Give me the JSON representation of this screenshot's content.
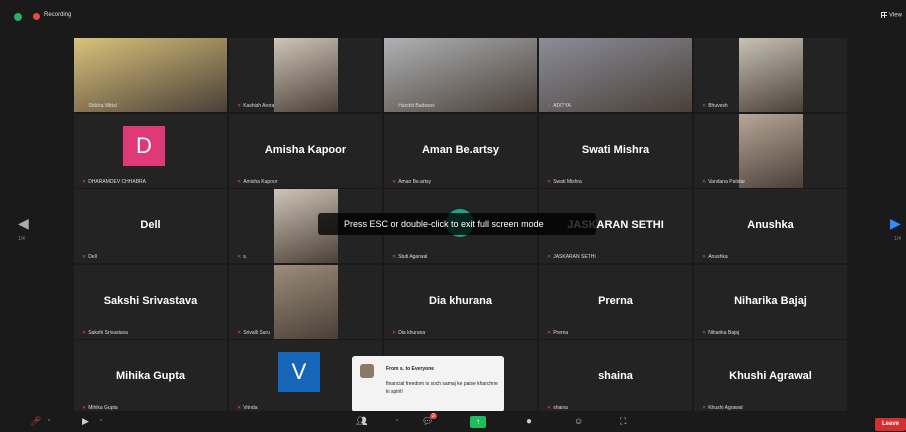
{
  "topbar": {
    "recording_label": "Recording",
    "view_label": "View"
  },
  "toast": "Press ESC or double-click to exit full screen mode",
  "pagination": {
    "left": "1/4",
    "right": "1/4"
  },
  "participants": [
    {
      "name": "Shikha Mittal",
      "display": "",
      "video": true
    },
    {
      "name": "Kashish Arora",
      "display": "",
      "video": true
    },
    {
      "name": "Harshit Badwani",
      "display": "",
      "video": true
    },
    {
      "name": "ADITYA",
      "display": "",
      "video": true
    },
    {
      "name": "Bhuvesh",
      "display": "",
      "video": true
    },
    {
      "name": "DHARAMDEV CHHABRA",
      "display": "",
      "avatar_letter": "D",
      "avatar_color": "#e0397a"
    },
    {
      "name": "Amisha Kapoor",
      "display": "Amisha Kapoor"
    },
    {
      "name": "Aman Be.artsy",
      "display": "Aman Be.artsy"
    },
    {
      "name": "Swati Mishra",
      "display": "Swati Mishra"
    },
    {
      "name": "Vandana Patidar",
      "display": "",
      "video": true
    },
    {
      "name": "Dell",
      "display": "Dell"
    },
    {
      "name": "s.",
      "display": "",
      "video": true
    },
    {
      "name": "Stuti Agarwal",
      "display": "",
      "avatar_color": "#1ca58b"
    },
    {
      "name": "JASKARAN SETHI",
      "display": "JASKARAN SETHI"
    },
    {
      "name": "Anushka",
      "display": "Anushka"
    },
    {
      "name": "Sakshi Srivastava",
      "display": "Sakshi Srivastava"
    },
    {
      "name": "Srivalli Suru",
      "display": "",
      "video": true
    },
    {
      "name": "Dia khurana",
      "display": "Dia khurana"
    },
    {
      "name": "Prerna",
      "display": "Prerna"
    },
    {
      "name": "Niharika Bajaj",
      "display": "Niharika Bajaj"
    },
    {
      "name": "Mihika Gupta",
      "display": "Mihika Gupta"
    },
    {
      "name": "Vrinda",
      "display": "",
      "avatar_letter": "V",
      "avatar_color": "#1565b8"
    },
    {
      "name": "",
      "display": ""
    },
    {
      "name": "shaina",
      "display": "shaina"
    },
    {
      "name": "Khushi Agrawal",
      "display": "Khushi Agrawal"
    }
  ],
  "chat": {
    "from": "From s. to Everyone",
    "message": "financial freedom is soch samaj ke paise kharchne ki spirit!"
  },
  "toolbar": {
    "chat_badge": "2",
    "leave_label": "Leave"
  },
  "colors": {
    "active_speaker": "#c6e04c",
    "leave": "#d32f2f",
    "muted_mic": "#e74c3c",
    "share": "#1ebc5b"
  }
}
